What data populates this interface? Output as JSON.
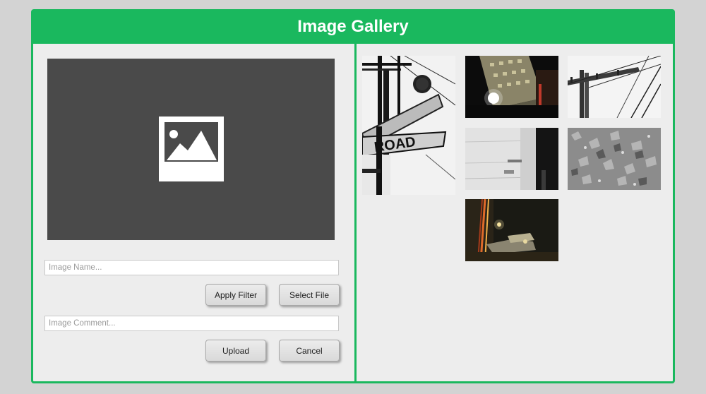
{
  "window": {
    "title": "Image Gallery",
    "accent_color": "#1ab85e"
  },
  "editor": {
    "preview_icon": "image-placeholder-icon",
    "name_field": {
      "value": "",
      "placeholder": "Image Name..."
    },
    "comment_field": {
      "value": "",
      "placeholder": "Image Comment..."
    },
    "buttons": {
      "apply_filter": "Apply Filter",
      "select_file": "Select File",
      "upload": "Upload",
      "cancel": "Cancel"
    }
  },
  "gallery": {
    "thumbnails": [
      {
        "subject": "stop sign and road sign in black and white"
      },
      {
        "subject": "city building at night with streetlight"
      },
      {
        "subject": "utility pole with power lines"
      },
      {
        "subject": "white wall with door in black and white"
      },
      {
        "subject": "broken glass on ground in black and white"
      },
      {
        "subject": "night street with light trails"
      }
    ]
  }
}
